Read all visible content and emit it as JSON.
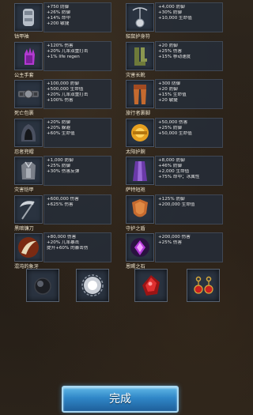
{
  "items_left": [
    {
      "name": "钴甲袖",
      "icon": "bracer-icon",
      "stats": [
        "+750 防御",
        "+26% 防御",
        "+14% 命中",
        "+200 敏捷"
      ]
    },
    {
      "name": "公主手套",
      "icon": "glove-icon",
      "stats": [
        "+120% 伤害",
        "+20% 几率双重打击",
        "+1% life regen"
      ]
    },
    {
      "name": "死亡包裹",
      "icon": "belt-icon",
      "stats": [
        "+100,000 防御",
        "+500,000 生命值",
        "+20% 几率双重打击",
        "+100% 伤害"
      ]
    },
    {
      "name": "忍者兜帽",
      "icon": "hood-icon",
      "stats": [
        "+20% 防御",
        "+20% 躲避",
        "+60% 生命值"
      ]
    },
    {
      "name": "灾害铠甲",
      "icon": "armor-icon",
      "stats": [
        "+1,000 防御",
        "+25% 防御",
        "+30% 伤害反弹"
      ]
    },
    {
      "name": "黑暗镰刀",
      "icon": "scythe-icon",
      "stats": [
        "+600,000 伤害",
        "+625% 伤害"
      ]
    },
    {
      "name": "混沌的象牙",
      "icon": "tusk-icon",
      "stats": [
        "+80,000 伤害",
        "+20% 几率暴击",
        "提升+60% 的暴击伤"
      ]
    }
  ],
  "items_right": [
    {
      "name": "貂鼠护身符",
      "icon": "amulet-icon",
      "stats": [
        "+4,000 防御",
        "+30% 防御",
        "+10,000 生命值"
      ]
    },
    {
      "name": "灾害长靴",
      "icon": "boots-icon",
      "stats": [
        "+20 防御",
        "+25% 伤害",
        "+15% 移动速度"
      ]
    },
    {
      "name": "旅行者裹脚",
      "icon": "leggings-icon",
      "stats": [
        "+300 防御",
        "+20 防御",
        "+15% 生命值",
        "+20 敏捷"
      ]
    },
    {
      "name": "太阳护腕",
      "icon": "sun-bracer-icon",
      "stats": [
        "+50,000 伤害",
        "+25% 防御",
        "+50,000 生命值"
      ]
    },
    {
      "name": "萨特短袍",
      "icon": "robe-icon",
      "stats": [
        "+8,000 防御",
        "+46% 防御",
        "+2,000 生命值",
        "+75% 命中；冰属性"
      ]
    },
    {
      "name": "守护之盾",
      "icon": "shield-icon",
      "stats": [
        "+125% 防御",
        "+200,000 生命值"
      ]
    },
    {
      "name": "恩赐之石",
      "icon": "stone-icon",
      "stats": [
        "+200,000 伤害",
        "+25% 伤害"
      ]
    }
  ],
  "gems": [
    {
      "icon": "dark-orb-icon"
    },
    {
      "icon": "silver-orb-icon"
    },
    {
      "icon": "red-crystal-icon"
    },
    {
      "icon": "earrings-icon"
    }
  ],
  "done_label": "完成",
  "colors": {
    "stat_text": "#e6e6e6",
    "name_text": "#f0e6cf",
    "button_top": "#5fb7e6",
    "button_bottom": "#1e5f9a"
  }
}
